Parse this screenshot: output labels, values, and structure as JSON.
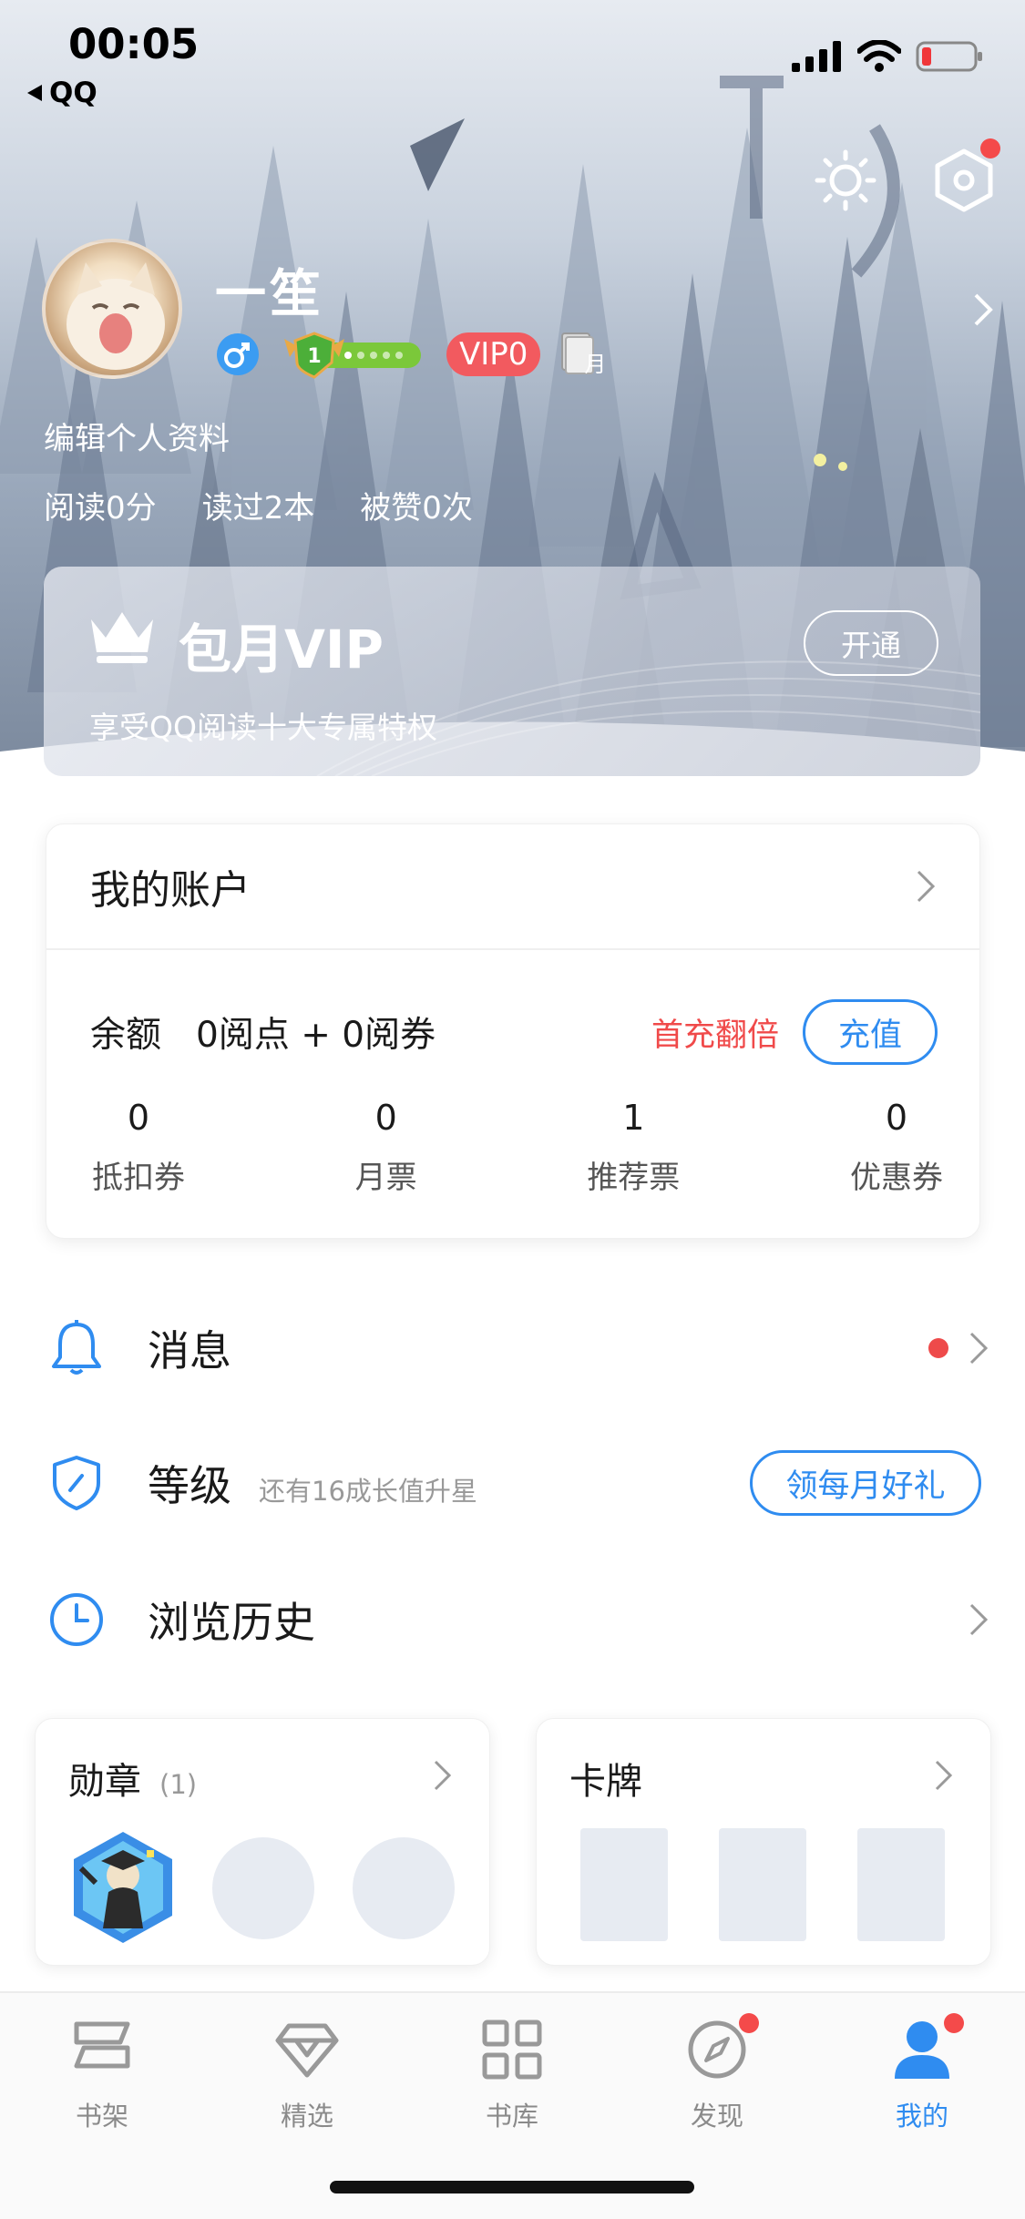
{
  "status_bar": {
    "time": "00:05",
    "back_app": "QQ"
  },
  "profile": {
    "username": "一笙",
    "level": "1",
    "vip_badge": "VIP0",
    "month_badge": "月",
    "edit_profile": "编辑个人资料",
    "stats": [
      "阅读0分",
      "读过2本",
      "被赞0次"
    ]
  },
  "vip_card": {
    "title": "包月VIP",
    "subtitle": "享受QQ阅读十大专属特权",
    "button": "开通"
  },
  "account": {
    "title": "我的账户",
    "balance_label": "余额",
    "balance_value": "0阅点 + 0阅券",
    "promo": "首充翻倍",
    "recharge": "充值",
    "items": [
      {
        "value": "0",
        "label": "抵扣券"
      },
      {
        "value": "0",
        "label": "月票"
      },
      {
        "value": "1",
        "label": "推荐票"
      },
      {
        "value": "0",
        "label": "优惠券"
      }
    ]
  },
  "menu": {
    "messages": "消息",
    "level": "等级",
    "level_hint": "还有16成长值升星",
    "level_button": "领每月好礼",
    "history": "浏览历史"
  },
  "cards": {
    "medals_title": "勋章",
    "medals_count": "(1)",
    "cards_title": "卡牌"
  },
  "tabs": [
    {
      "label": "书架",
      "icon": "bookshelf-icon"
    },
    {
      "label": "精选",
      "icon": "diamond-icon"
    },
    {
      "label": "书库",
      "icon": "grid-icon"
    },
    {
      "label": "发现",
      "icon": "compass-icon"
    },
    {
      "label": "我的",
      "icon": "user-icon"
    }
  ],
  "colors": {
    "accent": "#2f8cf0",
    "alert": "#f04a4a",
    "vip_badge": "#f25a5f"
  }
}
